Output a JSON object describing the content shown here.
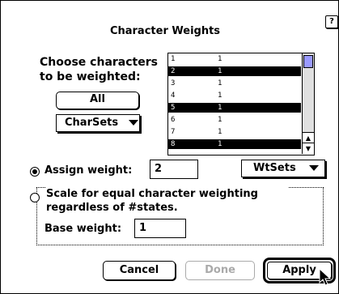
{
  "dialog": {
    "title": "Character Weights",
    "help_icon": "?"
  },
  "choose_label": "Choose characters to be weighted:",
  "buttons": {
    "all": "All",
    "charsets": "CharSets",
    "wtsets": "WtSets",
    "cancel": "Cancel",
    "done": "Done",
    "apply": "Apply"
  },
  "char_list": [
    {
      "num": "1",
      "weight": "1",
      "selected": false
    },
    {
      "num": "2",
      "weight": "1",
      "selected": true
    },
    {
      "num": "3",
      "weight": "1",
      "selected": false
    },
    {
      "num": "4",
      "weight": "1",
      "selected": false
    },
    {
      "num": "5",
      "weight": "1",
      "selected": true
    },
    {
      "num": "6",
      "weight": "1",
      "selected": false
    },
    {
      "num": "7",
      "weight": "1",
      "selected": false
    },
    {
      "num": "8",
      "weight": "1",
      "selected": true
    }
  ],
  "assign": {
    "label": "Assign weight:",
    "value": "2",
    "selected": true
  },
  "scale": {
    "label": "Scale for equal character weighting regardless of #states.",
    "selected": false,
    "base_label": "Base weight:",
    "base_value": "1"
  },
  "colors": {
    "scroll_thumb": "#9a9aff",
    "disabled_text": "#aaaaaa"
  }
}
